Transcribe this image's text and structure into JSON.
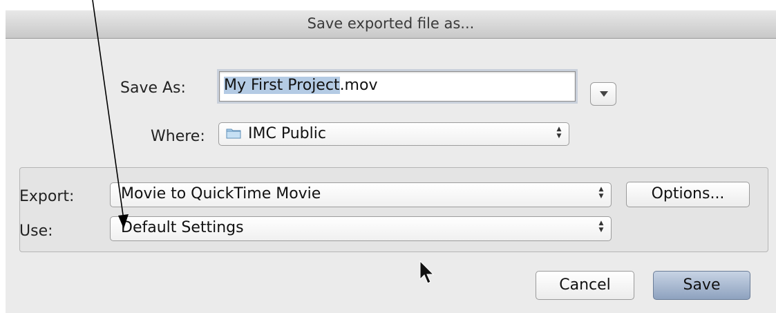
{
  "dialog": {
    "title": "Save exported file as...",
    "save_as_label": "Save As:",
    "filename_selected": "My First Project",
    "filename_ext": ".mov",
    "where_label": "Where:",
    "where_value": "IMC Public",
    "where_icon": "folder-icon",
    "expand_icon": "disclosure-triangle-icon"
  },
  "export_panel": {
    "export_label": "Export:",
    "export_value": "Movie to QuickTime Movie",
    "options_label": "Options...",
    "use_label": "Use:",
    "use_value": "Default Settings"
  },
  "buttons": {
    "cancel_label": "Cancel",
    "save_label": "Save"
  },
  "colors": {
    "selection": "#b4cbe4",
    "default_button": "#a9b9d1"
  }
}
